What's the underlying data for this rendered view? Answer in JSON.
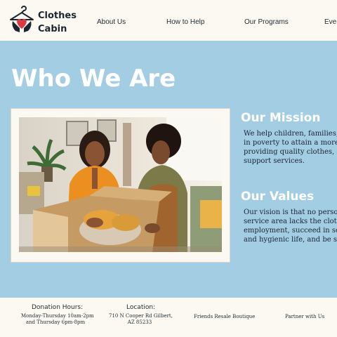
{
  "header": {
    "brand_line1": "Clothes",
    "brand_line2": "Cabin",
    "logo_icon": "hanger-heart-hands-icon",
    "nav": [
      "About Us",
      "How to Help",
      "Our Programs",
      "Events"
    ]
  },
  "main": {
    "title": "Who We Are",
    "mission": {
      "heading": "Our Mission",
      "lines": [
        "We help children, families, a",
        "in poverty to attain a more s",
        "providing quality clothes, sh",
        "support services."
      ]
    },
    "values": {
      "heading": "Our Values",
      "lines": [
        "Our vision is that no person",
        "service area lacks the clothi",
        "employment, succeed in sch",
        "and hygienic life, and be sel"
      ]
    }
  },
  "footer": {
    "hours_heading": "Donation Hours:",
    "hours_lines": [
      "Monday-Thursday 10am-2pm",
      "and Thursday 6pm-8pm"
    ],
    "location_heading": "Location:",
    "location_lines": [
      "710 N Cooper Rd Gilbert,",
      "AZ 85233"
    ],
    "link_boutique": "Friends Resale Boutique",
    "link_partner": "Partner with Us"
  },
  "colors": {
    "background": "#a3cde3",
    "header_bg": "#fbf9f1",
    "heart": "#d93b45",
    "text_dark": "#1b2631"
  }
}
